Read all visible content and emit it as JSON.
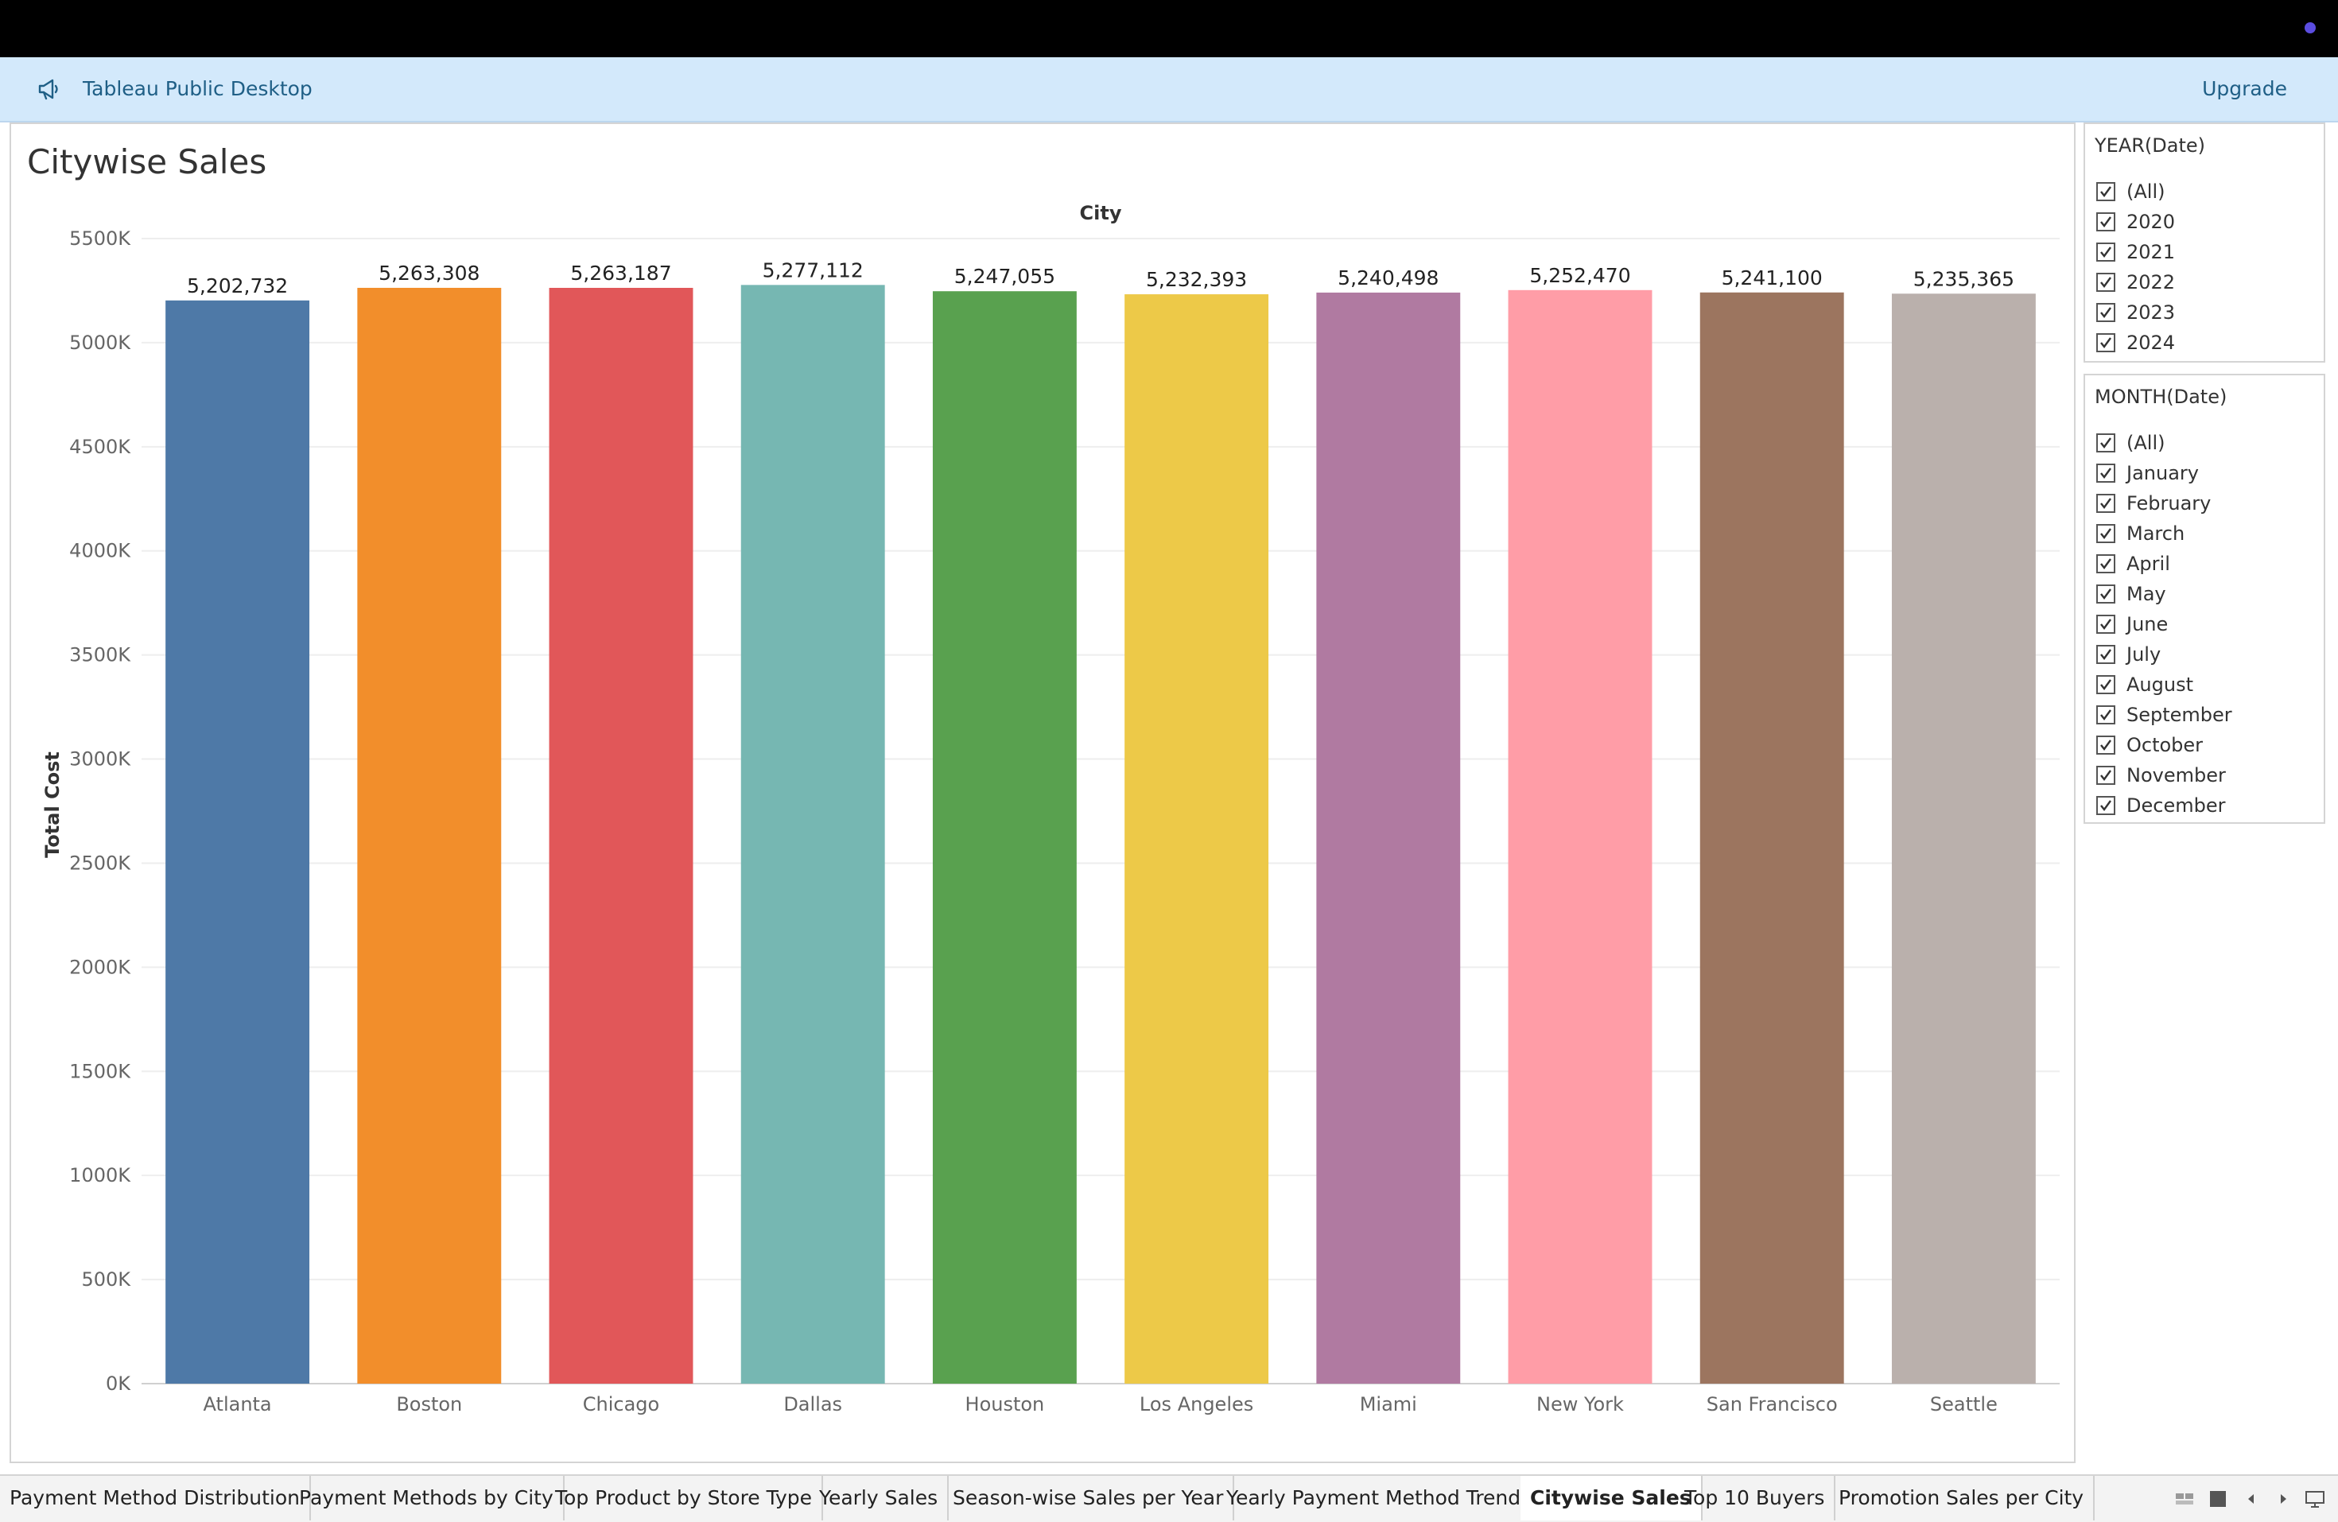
{
  "app": {
    "banner_title": "Tableau Public Desktop",
    "upgrade_label": "Upgrade"
  },
  "sheet": {
    "title": "Citywise Sales"
  },
  "chart_data": {
    "type": "bar",
    "title": "",
    "top_axis_label": "City",
    "xlabel": "",
    "ylabel": "Total Cost",
    "categories": [
      "Atlanta",
      "Boston",
      "Chicago",
      "Dallas",
      "Houston",
      "Los Angeles",
      "Miami",
      "New York",
      "San Francisco",
      "Seattle"
    ],
    "values": [
      5202732,
      5263308,
      5263187,
      5277112,
      5247055,
      5232393,
      5240498,
      5252470,
      5241100,
      5235365
    ],
    "value_labels": [
      "5,202,732",
      "5,263,308",
      "5,263,187",
      "5,277,112",
      "5,247,055",
      "5,232,393",
      "5,240,498",
      "5,252,470",
      "5,241,100",
      "5,235,365"
    ],
    "colors": [
      "#4e79a7",
      "#f28e2b",
      "#e15759",
      "#76b7b2",
      "#59a14f",
      "#edc948",
      "#b07aa1",
      "#ff9da7",
      "#9c755f",
      "#bab0ac"
    ],
    "ylim": [
      0,
      5500000
    ],
    "yticks": [
      0,
      500000,
      1000000,
      1500000,
      2000000,
      2500000,
      3000000,
      3500000,
      4000000,
      4500000,
      5000000,
      5500000
    ],
    "ytick_labels": [
      "0K",
      "500K",
      "1000K",
      "1500K",
      "2000K",
      "2500K",
      "3000K",
      "3500K",
      "4000K",
      "4500K",
      "5000K",
      "5500K"
    ],
    "grid": true,
    "legend": "none"
  },
  "filters": {
    "year": {
      "title": "YEAR(Date)",
      "items": [
        {
          "label": "(All)",
          "checked": true
        },
        {
          "label": "2020",
          "checked": true
        },
        {
          "label": "2021",
          "checked": true
        },
        {
          "label": "2022",
          "checked": true
        },
        {
          "label": "2023",
          "checked": true
        },
        {
          "label": "2024",
          "checked": true
        }
      ]
    },
    "month": {
      "title": "MONTH(Date)",
      "items": [
        {
          "label": "(All)",
          "checked": true
        },
        {
          "label": "January",
          "checked": true
        },
        {
          "label": "February",
          "checked": true
        },
        {
          "label": "March",
          "checked": true
        },
        {
          "label": "April",
          "checked": true
        },
        {
          "label": "May",
          "checked": true
        },
        {
          "label": "June",
          "checked": true
        },
        {
          "label": "July",
          "checked": true
        },
        {
          "label": "August",
          "checked": true
        },
        {
          "label": "September",
          "checked": true
        },
        {
          "label": "October",
          "checked": true
        },
        {
          "label": "November",
          "checked": true
        },
        {
          "label": "December",
          "checked": true
        }
      ]
    }
  },
  "tabs": [
    {
      "label": "Payment Method Distribution",
      "active": false
    },
    {
      "label": "Payment Methods by City",
      "active": false
    },
    {
      "label": "Top Product by Store Type",
      "active": false
    },
    {
      "label": "Yearly Sales",
      "active": false
    },
    {
      "label": "Season-wise Sales per Year",
      "active": false
    },
    {
      "label": "Yearly Payment Method Trends",
      "active": false
    },
    {
      "label": "Citywise Sales",
      "active": true
    },
    {
      "label": "Top 10 Buyers",
      "active": false
    },
    {
      "label": "Promotion Sales per City",
      "active": false
    }
  ],
  "nav_icons": [
    "filmstrip-view-icon",
    "single-sheet-view-icon",
    "previous-sheet-icon",
    "next-sheet-icon",
    "presentation-mode-icon"
  ]
}
